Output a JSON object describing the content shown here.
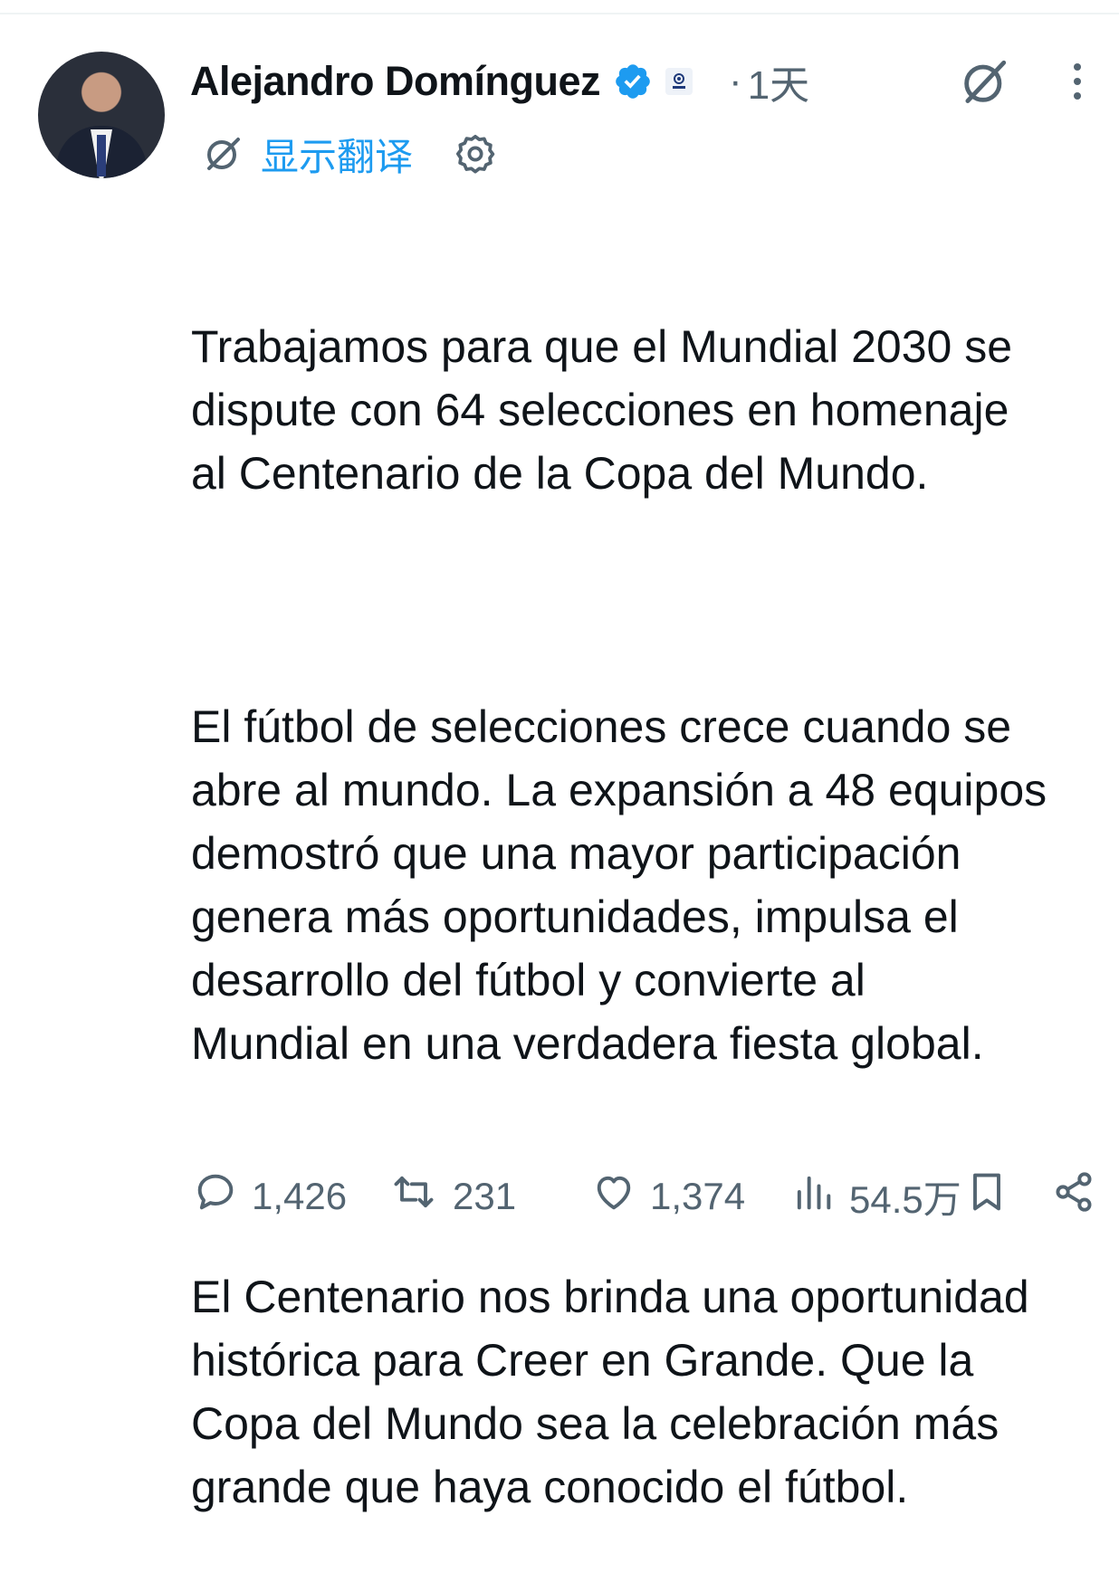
{
  "tweet": {
    "author_name": "Alejandro Domínguez",
    "separator": "·",
    "timestamp": "1天",
    "translate_label": "显示翻译",
    "paragraphs": [
      "Trabajamos para que el Mundial 2030 se\ndispute con 64 selecciones en homenaje\nal Centenario de la Copa del Mundo.",
      "El fútbol de selecciones crece cuando se\nabre al mundo. La expansión a 48 equipos\ndemostró que una mayor participación\ngenera más oportunidades, impulsa el\ndesarrollo del fútbol y convierte al\nMundial en una verdadera fiesta global.",
      "El Centenario nos brinda una oportunidad\nhistórica para Creer en Grande. Que la\nCopa del Mundo sea la celebración más\ngrande que haya conocido el fútbol."
    ],
    "actions": {
      "replies": "1,426",
      "reposts": "231",
      "likes": "1,374",
      "views": "54.5万"
    }
  },
  "icons": {
    "verified": "verified-badge-icon",
    "affiliate": "affiliate-badge-icon",
    "grok": "grok-icon",
    "more": "more-options-icon",
    "translate": "translate-icon",
    "settings": "gear-icon",
    "reply": "reply-icon",
    "repost": "repost-icon",
    "like": "heart-icon",
    "views": "views-chart-icon",
    "bookmark": "bookmark-icon",
    "share": "share-icon"
  },
  "colors": {
    "text": "#0f1419",
    "secondary": "#536471",
    "accent": "#1d9bf0"
  }
}
